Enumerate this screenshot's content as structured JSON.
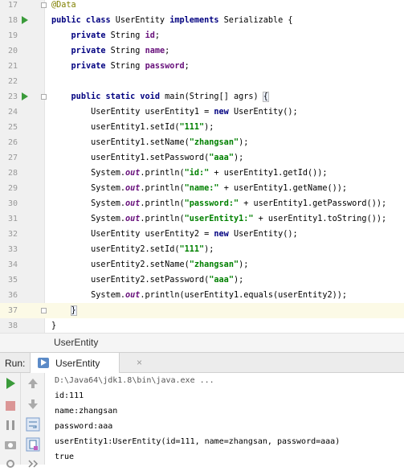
{
  "editor": {
    "lines": [
      {
        "num": "17",
        "segs": [
          {
            "t": "@Data",
            "c": "ann"
          }
        ]
      },
      {
        "num": "18",
        "segs": [
          {
            "t": "public class ",
            "c": "kw"
          },
          {
            "t": "UserEntity ",
            "c": ""
          },
          {
            "t": "implements ",
            "c": "kw"
          },
          {
            "t": "Serializable {",
            "c": ""
          }
        ]
      },
      {
        "num": "19",
        "segs": [
          {
            "t": "    ",
            "c": ""
          },
          {
            "t": "private ",
            "c": "kw"
          },
          {
            "t": "String ",
            "c": ""
          },
          {
            "t": "id",
            "c": "fld"
          },
          {
            "t": ";",
            "c": ""
          }
        ]
      },
      {
        "num": "20",
        "segs": [
          {
            "t": "    ",
            "c": ""
          },
          {
            "t": "private ",
            "c": "kw"
          },
          {
            "t": "String ",
            "c": ""
          },
          {
            "t": "name",
            "c": "fld"
          },
          {
            "t": ";",
            "c": ""
          }
        ]
      },
      {
        "num": "21",
        "segs": [
          {
            "t": "    ",
            "c": ""
          },
          {
            "t": "private ",
            "c": "kw"
          },
          {
            "t": "String ",
            "c": ""
          },
          {
            "t": "password",
            "c": "fld"
          },
          {
            "t": ";",
            "c": ""
          }
        ]
      },
      {
        "num": "22",
        "segs": []
      },
      {
        "num": "23",
        "segs": [
          {
            "t": "    ",
            "c": ""
          },
          {
            "t": "public static void ",
            "c": "kw"
          },
          {
            "t": "main(String[] agrs) ",
            "c": ""
          },
          {
            "t": "{",
            "c": "brace"
          }
        ]
      },
      {
        "num": "24",
        "segs": [
          {
            "t": "        UserEntity userEntity1 = ",
            "c": ""
          },
          {
            "t": "new ",
            "c": "kw"
          },
          {
            "t": "UserEntity();",
            "c": ""
          }
        ]
      },
      {
        "num": "25",
        "segs": [
          {
            "t": "        userEntity1.setId(",
            "c": ""
          },
          {
            "t": "\"111\"",
            "c": "st"
          },
          {
            "t": ");",
            "c": ""
          }
        ]
      },
      {
        "num": "26",
        "segs": [
          {
            "t": "        userEntity1.setName(",
            "c": ""
          },
          {
            "t": "\"zhangsan\"",
            "c": "st"
          },
          {
            "t": ");",
            "c": ""
          }
        ]
      },
      {
        "num": "27",
        "segs": [
          {
            "t": "        userEntity1.setPassword(",
            "c": ""
          },
          {
            "t": "\"aaa\"",
            "c": "st"
          },
          {
            "t": ");",
            "c": ""
          }
        ]
      },
      {
        "num": "28",
        "segs": [
          {
            "t": "        System.",
            "c": ""
          },
          {
            "t": "out",
            "c": "so"
          },
          {
            "t": ".println(",
            "c": ""
          },
          {
            "t": "\"id:\"",
            "c": "st"
          },
          {
            "t": " + userEntity1.getId());",
            "c": ""
          }
        ]
      },
      {
        "num": "29",
        "segs": [
          {
            "t": "        System.",
            "c": ""
          },
          {
            "t": "out",
            "c": "so"
          },
          {
            "t": ".println(",
            "c": ""
          },
          {
            "t": "\"name:\"",
            "c": "st"
          },
          {
            "t": " + userEntity1.getName());",
            "c": ""
          }
        ]
      },
      {
        "num": "30",
        "segs": [
          {
            "t": "        System.",
            "c": ""
          },
          {
            "t": "out",
            "c": "so"
          },
          {
            "t": ".println(",
            "c": ""
          },
          {
            "t": "\"password:\"",
            "c": "st"
          },
          {
            "t": " + userEntity1.getPassword());",
            "c": ""
          }
        ]
      },
      {
        "num": "31",
        "segs": [
          {
            "t": "        System.",
            "c": ""
          },
          {
            "t": "out",
            "c": "so"
          },
          {
            "t": ".println(",
            "c": ""
          },
          {
            "t": "\"userEntity1:\"",
            "c": "st"
          },
          {
            "t": " + userEntity1.toString());",
            "c": ""
          }
        ]
      },
      {
        "num": "32",
        "segs": [
          {
            "t": "        UserEntity userEntity2 = ",
            "c": ""
          },
          {
            "t": "new ",
            "c": "kw"
          },
          {
            "t": "UserEntity();",
            "c": ""
          }
        ]
      },
      {
        "num": "33",
        "segs": [
          {
            "t": "        userEntity2.setId(",
            "c": ""
          },
          {
            "t": "\"111\"",
            "c": "st"
          },
          {
            "t": ");",
            "c": ""
          }
        ]
      },
      {
        "num": "34",
        "segs": [
          {
            "t": "        userEntity2.setName(",
            "c": ""
          },
          {
            "t": "\"zhangsan\"",
            "c": "st"
          },
          {
            "t": ");",
            "c": ""
          }
        ]
      },
      {
        "num": "35",
        "segs": [
          {
            "t": "        userEntity2.setPassword(",
            "c": ""
          },
          {
            "t": "\"aaa\"",
            "c": "st"
          },
          {
            "t": ");",
            "c": ""
          }
        ]
      },
      {
        "num": "36",
        "segs": [
          {
            "t": "        System.",
            "c": ""
          },
          {
            "t": "out",
            "c": "so"
          },
          {
            "t": ".println(userEntity1.equals(userEntity2));",
            "c": ""
          }
        ]
      },
      {
        "num": "37",
        "segs": [
          {
            "t": "    ",
            "c": ""
          },
          {
            "t": "}",
            "c": "brace"
          }
        ],
        "current": true
      },
      {
        "num": "38",
        "segs": [
          {
            "t": "}",
            "c": ""
          }
        ]
      }
    ],
    "run_gutter_lines": [
      "18",
      "23"
    ],
    "fold_lines": [
      "17",
      "23",
      "37"
    ]
  },
  "breadcrumb": {
    "label": "UserEntity"
  },
  "run_panel": {
    "run_label": "Run:",
    "tab_label": "UserEntity",
    "close_glyph": "×",
    "console": [
      {
        "text": "D:\\Java64\\jdk1.8\\bin\\java.exe ...",
        "cls": "cmd"
      },
      {
        "text": "id:111",
        "cls": ""
      },
      {
        "text": "name:zhangsan",
        "cls": ""
      },
      {
        "text": "password:aaa",
        "cls": ""
      },
      {
        "text": "userEntity1:UserEntity(id=111, name=zhangsan, password=aaa)",
        "cls": ""
      },
      {
        "text": "true",
        "cls": ""
      }
    ]
  },
  "colors": {
    "keyword": "#000080",
    "annotation": "#808000",
    "field": "#660e7a",
    "string": "#008000",
    "current_line": "#fcfae6",
    "run_green": "#3a9b3a"
  }
}
